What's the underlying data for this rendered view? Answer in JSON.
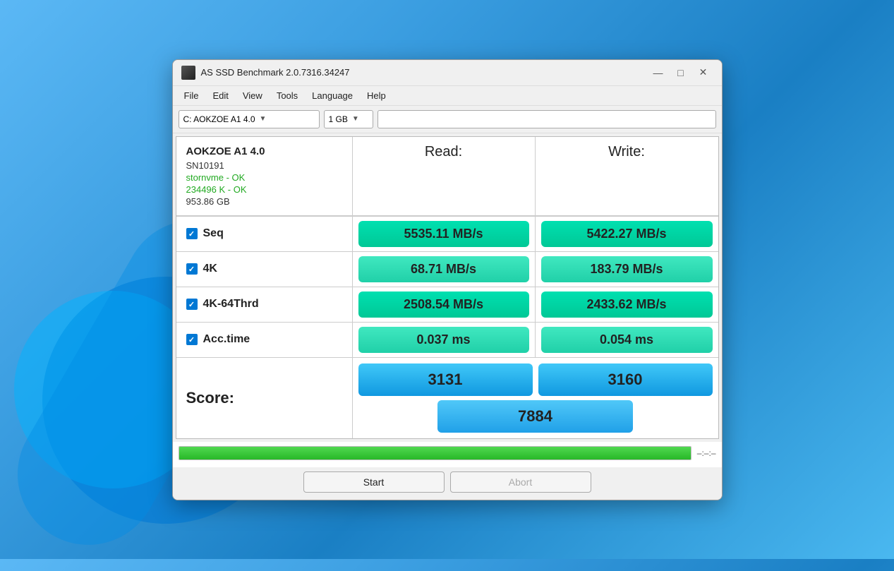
{
  "window": {
    "title": "AS SSD Benchmark 2.0.7316.34247",
    "icon": "disk-icon"
  },
  "controls": {
    "minimize": "—",
    "maximize": "□",
    "close": "✕"
  },
  "menu": {
    "items": [
      "File",
      "Edit",
      "View",
      "Tools",
      "Language",
      "Help"
    ]
  },
  "toolbar": {
    "drive_label": "C: AOKZOE A1 4.0",
    "size_label": "1 GB"
  },
  "drive_info": {
    "name": "AOKZOE A1 4.0",
    "serial": "SN10191",
    "driver": "stornvme - OK",
    "size_ok": "234496 K - OK",
    "gb": "953.86 GB"
  },
  "headers": {
    "read": "Read:",
    "write": "Write:"
  },
  "tests": [
    {
      "label": "Seq",
      "read": "5535.11 MB/s",
      "write": "5422.27 MB/s"
    },
    {
      "label": "4K",
      "read": "68.71 MB/s",
      "write": "183.79 MB/s"
    },
    {
      "label": "4K-64Thrd",
      "read": "2508.54 MB/s",
      "write": "2433.62 MB/s"
    },
    {
      "label": "Acc.time",
      "read": "0.037 ms",
      "write": "0.054 ms"
    }
  ],
  "score": {
    "label": "Score:",
    "read": "3131",
    "write": "3160",
    "total": "7884"
  },
  "progress": {
    "timer": "–:–:–"
  },
  "buttons": {
    "start": "Start",
    "abort": "Abort"
  }
}
